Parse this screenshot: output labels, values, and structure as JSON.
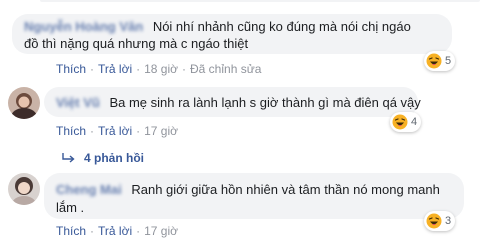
{
  "comments": [
    {
      "author": "Nguyễn Hoàng Vân",
      "text_line1": "Nói nhí nhảnh cũng ko đúng mà nói chị ngáo",
      "text_line2": "đồ thì nặng quá nhưng mà c ngáo thiệt",
      "like": "Thích",
      "reply": "Trả lời",
      "time": "18 giờ",
      "edited": "Đã chỉnh sửa",
      "reaction_count": "5"
    },
    {
      "author": "Việt Vũ",
      "text_line1": "Ba mẹ sinh ra lành lạnh s giờ thành gì mà điên qá vậy",
      "like": "Thích",
      "reply": "Trả lời",
      "time": "17 giờ",
      "reaction_count": "4"
    },
    {
      "author": "Cheng Mai",
      "text_line1": "Ranh giới giữa hồn nhiên và tâm thần nó mong manh",
      "text_line2": "lắm .",
      "like": "Thích",
      "reply": "Trả lời",
      "time": "17 giờ",
      "reaction_count": "3"
    }
  ],
  "replies_link": "4 phản hồi",
  "colors": {
    "link": "#385898",
    "bubble": "#f2f3f5",
    "muted": "#90949c",
    "reaction_emoji": "#f7b125",
    "tongue": "#e24667"
  },
  "icons": [
    "laughing-emoji-icon",
    "reply-arrow-icon"
  ]
}
